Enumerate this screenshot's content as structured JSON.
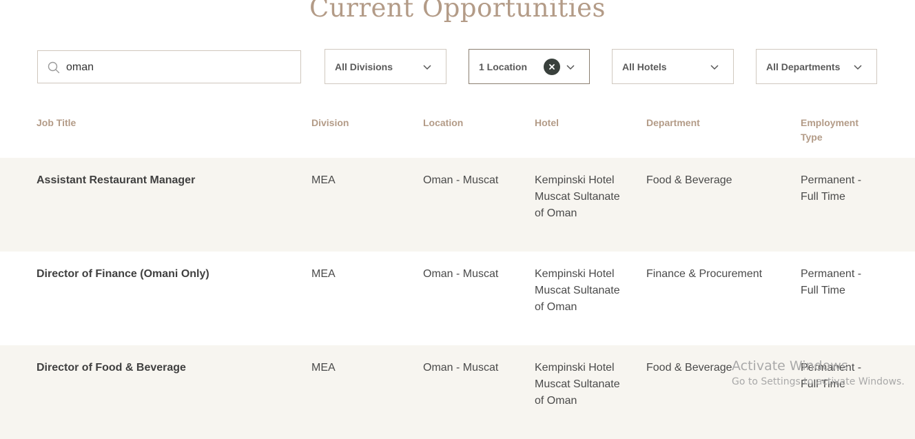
{
  "page": {
    "title": "Current Opportunities"
  },
  "search": {
    "value": "oman",
    "icon": "search-icon"
  },
  "filters": {
    "divisions": {
      "label": "All Divisions"
    },
    "location": {
      "label": "1 Location"
    },
    "hotels": {
      "label": "All Hotels"
    },
    "departments": {
      "label": "All Departments"
    }
  },
  "table": {
    "headers": {
      "job_title": "Job Title",
      "division": "Division",
      "location": "Location",
      "hotel": "Hotel",
      "department": "Department",
      "employment_type": "Employment Type"
    },
    "rows": [
      {
        "job_title": "Assistant Restaurant Manager",
        "division": "MEA",
        "location": "Oman - Muscat",
        "hotel": "Kempinski Hotel Muscat Sultanate of Oman",
        "department": "Food & Beverage",
        "employment_type": "Permanent - Full Time"
      },
      {
        "job_title": "Director of Finance (Omani Only)",
        "division": "MEA",
        "location": "Oman - Muscat",
        "hotel": "Kempinski Hotel Muscat Sultanate of Oman",
        "department": "Finance & Procurement",
        "employment_type": "Permanent - Full Time"
      },
      {
        "job_title": "Director of Food & Beverage",
        "division": "MEA",
        "location": "Oman - Muscat",
        "hotel": "Kempinski Hotel Muscat Sultanate of Oman",
        "department": "Food & Beverage",
        "employment_type": "Permanent - Full Time"
      }
    ]
  },
  "watermark": {
    "line1": "Activate Windows",
    "line2": "Go to Settings to activate Windows."
  },
  "colors": {
    "title": "#b39b87",
    "header": "#b39b87",
    "row_alt_bg": "#f7f5f0",
    "clear_badge": "#39403c"
  }
}
